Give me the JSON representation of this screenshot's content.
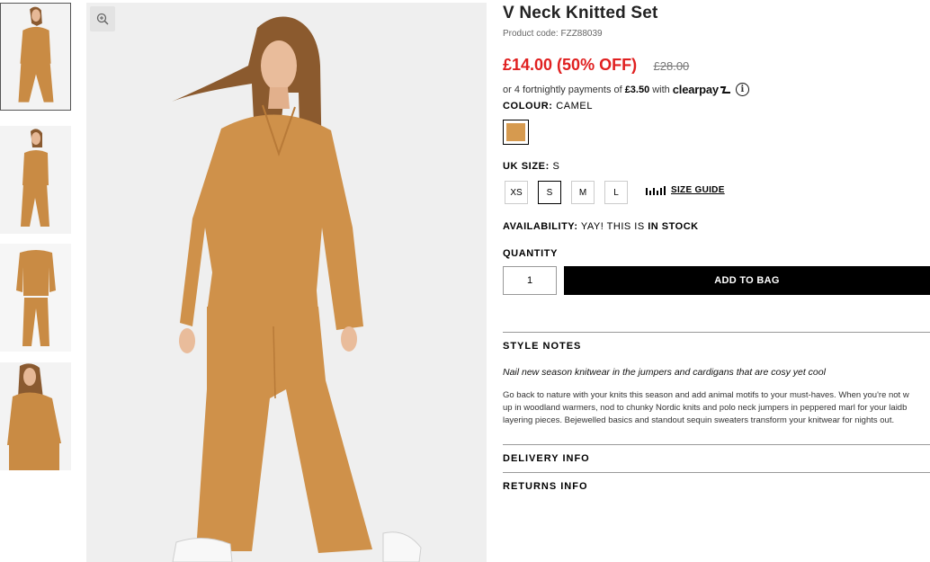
{
  "thumbnails": [
    {
      "alt": "model front view",
      "active": true
    },
    {
      "alt": "model side view",
      "active": false
    },
    {
      "alt": "product flat lay",
      "active": false
    },
    {
      "alt": "model close-up",
      "active": false
    }
  ],
  "main_image": {
    "zoom_icon": "magnifier-plus-icon"
  },
  "product": {
    "title": "V Neck Knitted Set",
    "code": "Product code: FZZ88039",
    "price": "£14.00 (50% OFF)",
    "old_price": "£28.00"
  },
  "clearpay": {
    "prefix": "or 4 fortnightly payments of",
    "amount": "£3.50",
    "with": "with",
    "logo": "clearpay"
  },
  "colour": {
    "label": "COLOUR:",
    "value": "CAMEL",
    "swatch_color": "#d69a4f"
  },
  "size": {
    "label": "UK SIZE:",
    "value": "S",
    "options": [
      "XS",
      "S",
      "M",
      "L"
    ],
    "selected": "S",
    "guide_label": "SIZE GUIDE"
  },
  "availability": {
    "label": "AVAILABILITY:",
    "text": "YAY! THIS IS",
    "status": "IN STOCK"
  },
  "quantity": {
    "label": "QUANTITY",
    "value": "1"
  },
  "add_to_bag": "ADD TO BAG",
  "style_notes": {
    "title": "STYLE NOTES",
    "lead": "Nail new season knitwear in the jumpers and cardigans that are cosy yet cool",
    "lines": [
      "Go back to nature with your knits this season and add animal motifs to your must-haves. When you're not w",
      "up in woodland warmers, nod to chunky Nordic knits and polo neck jumpers in peppered marl for your laidb",
      "layering pieces. Bejewelled basics and standout sequin sweaters transform your knitwear for nights out."
    ]
  },
  "delivery_info": "DELIVERY INFO",
  "returns_info": "RETURNS INFO",
  "colors": {
    "price_red": "#e02020",
    "camel": "#d69a4f",
    "button_black": "#000000"
  }
}
